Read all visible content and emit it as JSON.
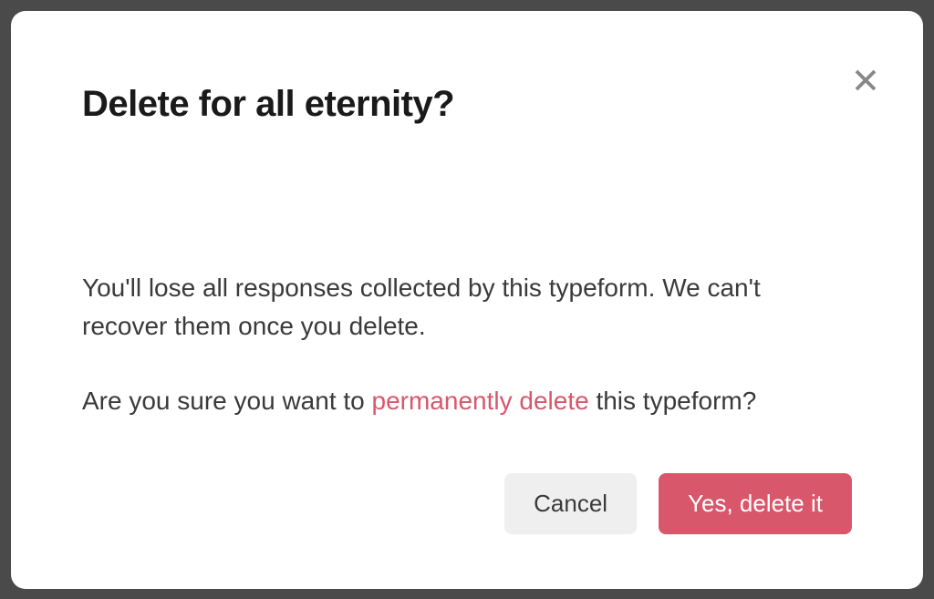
{
  "modal": {
    "title": "Delete for all eternity?",
    "body_line1": "You'll lose all responses collected by this typeform. We can't recover them once you delete.",
    "body_line2_part1": "Are you sure you want to ",
    "body_line2_emphasis": "permanently delete",
    "body_line2_part2": " this typeform?",
    "cancel_label": "Cancel",
    "confirm_label": "Yes, delete it"
  }
}
